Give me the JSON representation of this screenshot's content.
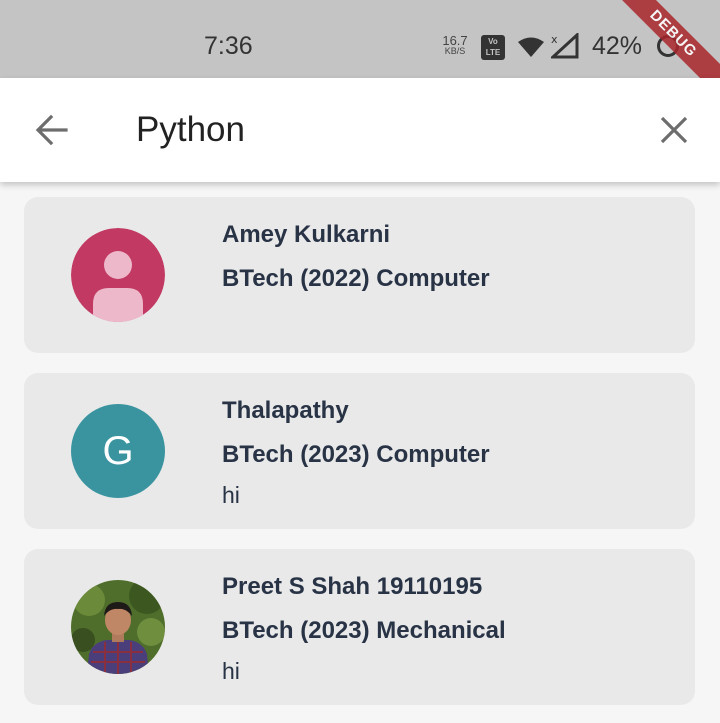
{
  "status_bar": {
    "time": "7:36",
    "net_speed_value": "16.7",
    "net_speed_unit": "KB/S",
    "volte": "Vo LTE",
    "battery": "42%",
    "debug_banner": "DEBUG"
  },
  "app_bar": {
    "search_value": "Python"
  },
  "results": [
    {
      "name": "Amey Kulkarni",
      "course": "BTech (2022) Computer",
      "bio": "",
      "avatar_type": "default-person",
      "avatar_color": "#c23a63"
    },
    {
      "name": "Thalapathy",
      "course": "BTech (2023) Computer",
      "bio": "hi",
      "avatar_type": "letter",
      "avatar_letter": "G",
      "avatar_color": "#3a94a0"
    },
    {
      "name": "Preet S Shah 19110195",
      "course": "BTech (2023) Mechanical",
      "bio": "hi",
      "avatar_type": "photo"
    }
  ]
}
